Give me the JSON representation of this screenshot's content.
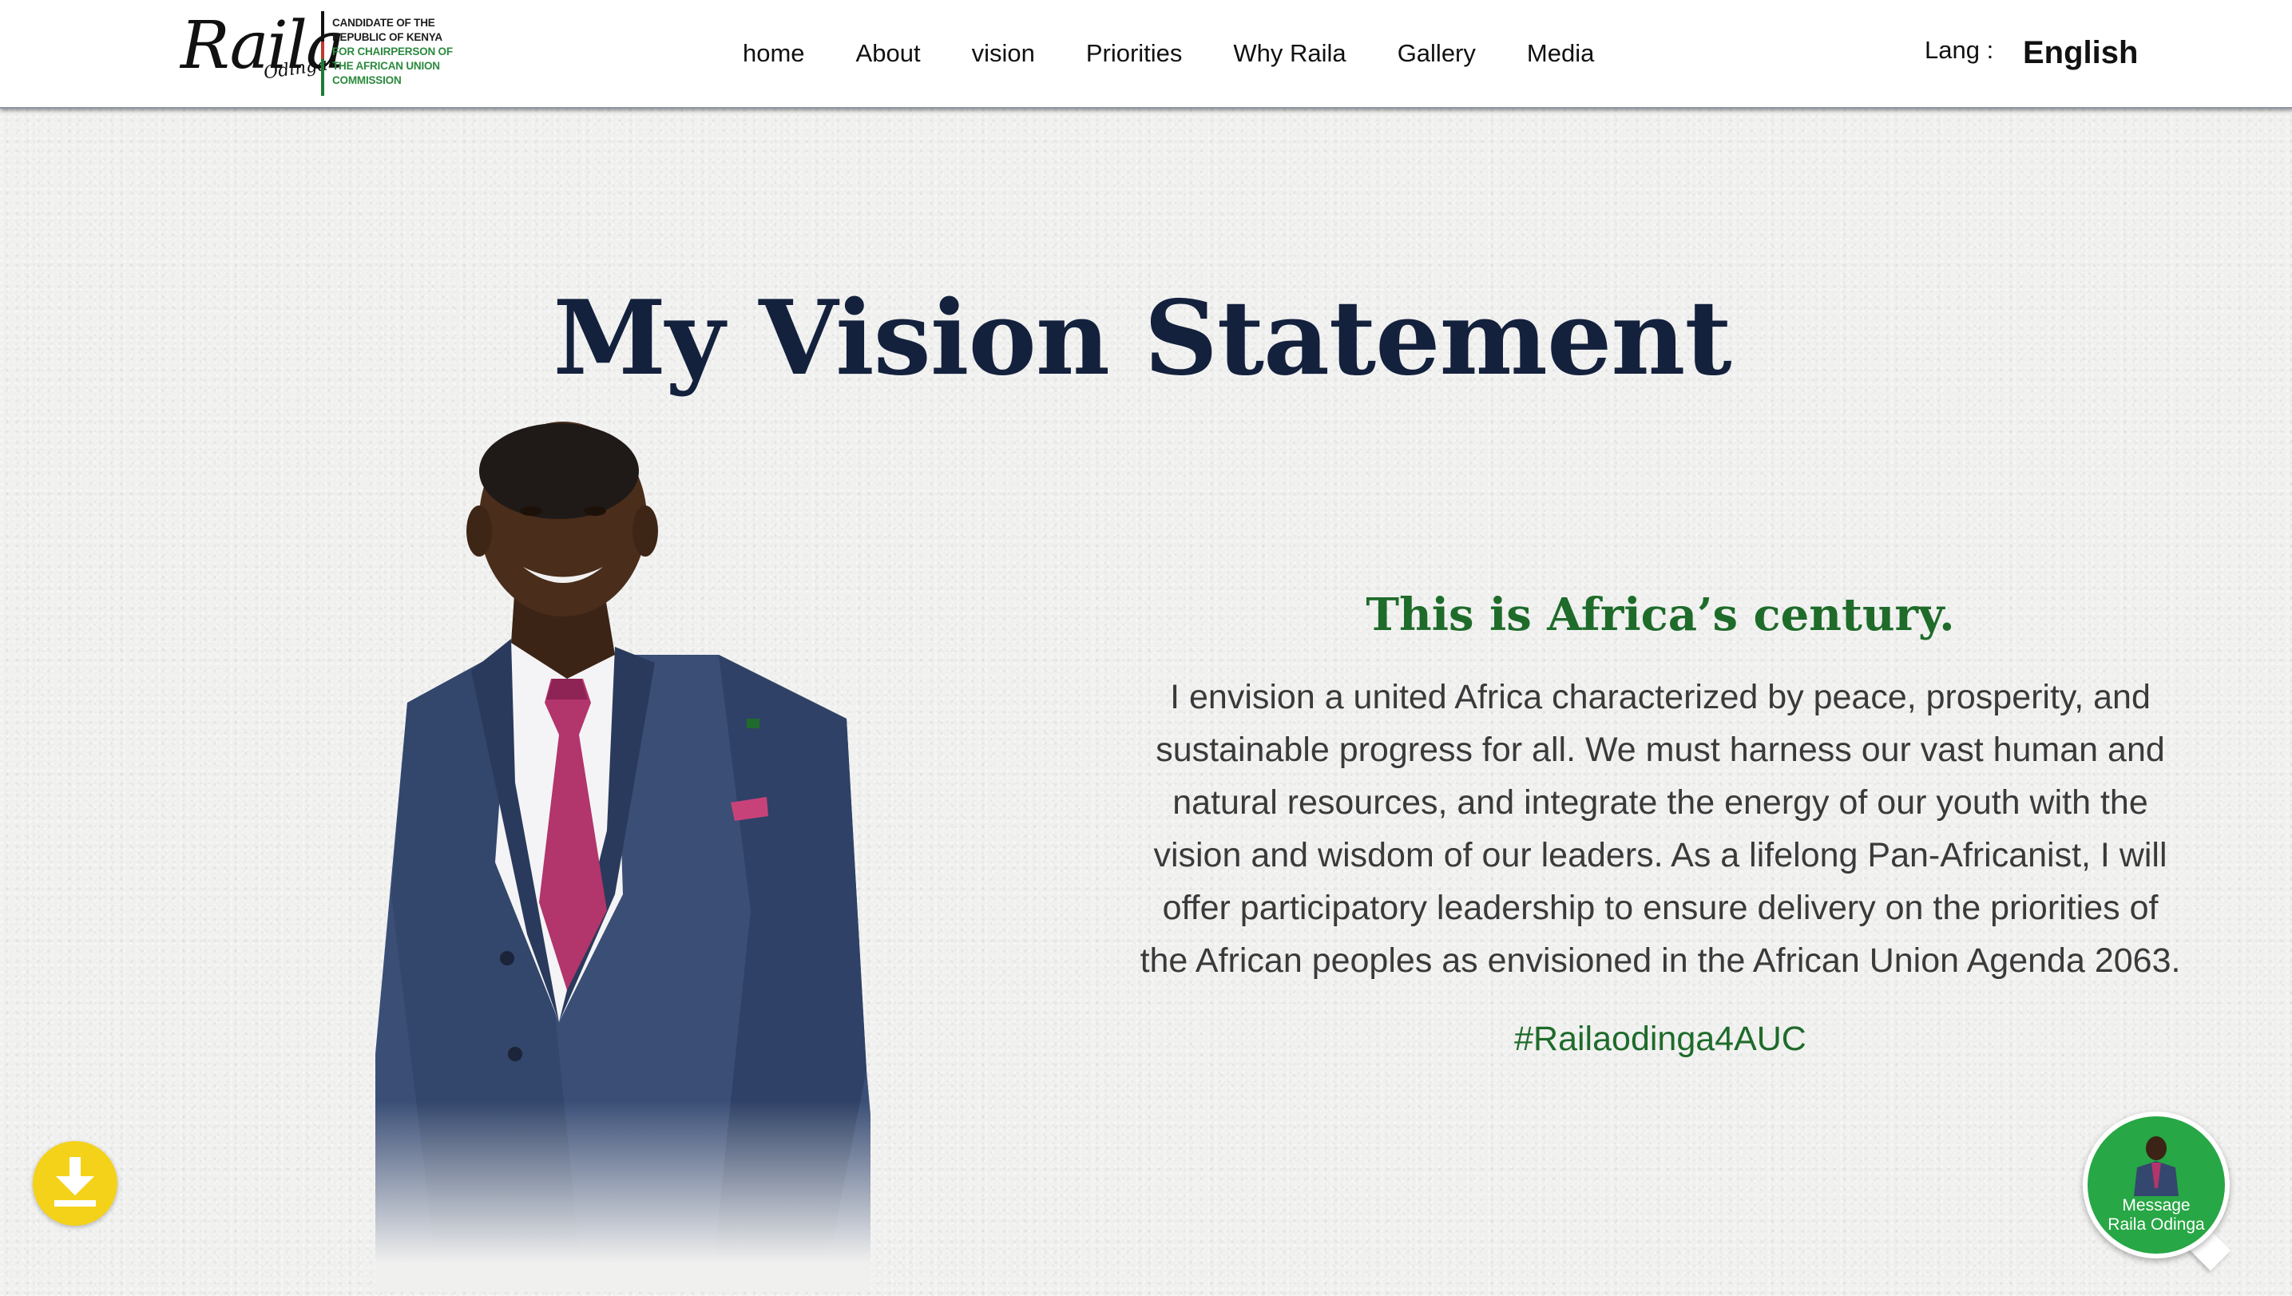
{
  "header": {
    "logo": {
      "script_name": "Raila",
      "script_sub": "Odinga",
      "lines": [
        {
          "text": "CANDIDATE OF THE",
          "tone": "dark"
        },
        {
          "text": "REPUBLIC OF KENYA",
          "tone": "dark"
        },
        {
          "text": "FOR CHAIRPERSON OF",
          "tone": "green"
        },
        {
          "text": "THE AFRICAN UNION",
          "tone": "green"
        },
        {
          "text": "COMMISSION",
          "tone": "green"
        }
      ]
    },
    "nav": [
      "home",
      "About",
      "vision",
      "Priorities",
      "Why Raila",
      "Gallery",
      "Media"
    ],
    "lang_label": "Lang :",
    "lang_value": "English"
  },
  "main": {
    "title": "My Vision Statement",
    "tagline": "This is Africa’s century.",
    "body": "I envision a united Africa characterized by peace, prosperity, and sustainable progress for all. We must harness our vast human and natural resources, and integrate the energy of our youth with the vision and wisdom of our leaders. As a lifelong Pan-Africanist, I will offer participatory leadership to ensure delivery on the priorities of the African peoples as envisioned in the African Union Agenda 2063.",
    "hashtag": "#Railaodinga4AUC"
  },
  "floating": {
    "download_icon": "download-icon",
    "message_label_line1": "Message",
    "message_label_line2": "Raila Odinga"
  },
  "colors": {
    "title": "#14213d",
    "accent_green": "#1e6b2a",
    "download": "#f5d21a",
    "message": "#27a745"
  }
}
